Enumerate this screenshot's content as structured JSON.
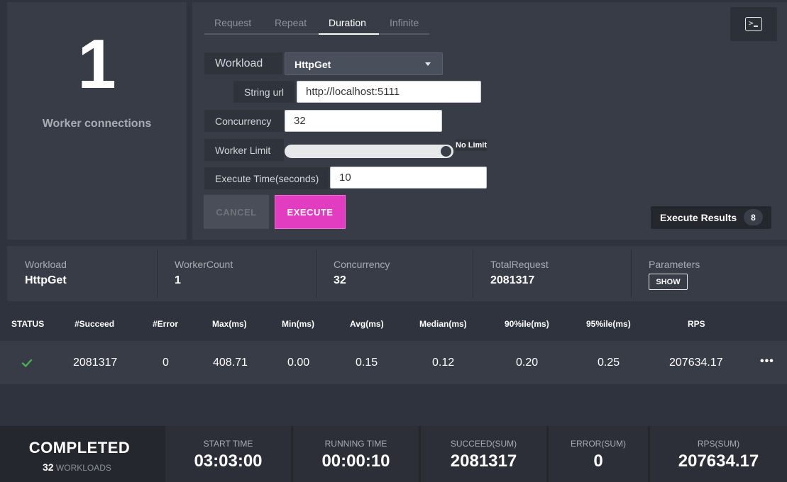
{
  "worker": {
    "count": "1",
    "label": "Worker connections"
  },
  "tabs": [
    "Request",
    "Repeat",
    "Duration",
    "Infinite"
  ],
  "active_tab": "Duration",
  "form": {
    "workload_label": "Workload",
    "workload_value": "HttpGet",
    "url_label": "String url",
    "url_value": "http://localhost:5111",
    "concurrency_label": "Concurrency",
    "concurrency_value": "32",
    "worker_limit_label": "Worker Limit",
    "worker_limit_value": "No Limit",
    "worker_limit_level": 1.0,
    "execute_time_label": "Execute Time(seconds)",
    "execute_time_value": "10"
  },
  "buttons": {
    "cancel": "CANCEL",
    "execute": "EXECUTE",
    "results": "Execute Results",
    "results_count": "8"
  },
  "summary": {
    "workload_label": "Workload",
    "workload_value": "HttpGet",
    "worker_count_label": "WorkerCount",
    "worker_count_value": "1",
    "concurrency_label": "Concurrency",
    "concurrency_value": "32",
    "total_request_label": "TotalRequest",
    "total_request_value": "2081317",
    "parameters_label": "Parameters",
    "show_label": "SHOW"
  },
  "table": {
    "headers": [
      "STATUS",
      "#Succeed",
      "#Error",
      "Max(ms)",
      "Min(ms)",
      "Avg(ms)",
      "Median(ms)",
      "90%ile(ms)",
      "95%ile(ms)",
      "RPS"
    ],
    "row": {
      "status": "success",
      "succeed": "2081317",
      "error": "0",
      "max": "408.71",
      "min": "0.00",
      "avg": "0.15",
      "median": "0.12",
      "p90": "0.20",
      "p95": "0.25",
      "rps": "207634.17"
    }
  },
  "footer": {
    "status": "COMPLETED",
    "workloads_count": "32",
    "workloads_label": "WORKLOADS",
    "start_time_label": "START TIME",
    "start_time_value": "03:03:00",
    "running_time_label": "RUNNING TIME",
    "running_time_value": "00:00:10",
    "succeed_label": "SUCCEED(SUM)",
    "succeed_value": "2081317",
    "error_label": "ERROR(SUM)",
    "error_value": "0",
    "rps_label": "RPS(SUM)",
    "rps_value": "207634.17"
  },
  "colors": {
    "accent": "#e23cc0",
    "success": "#4caf50",
    "background": "#2f333d",
    "panel": "#383c47"
  },
  "icons": {
    "terminal": "terminal-icon",
    "dropdown": "chevron-down-icon",
    "status": "check-icon",
    "more": "more-horizontal-icon"
  }
}
